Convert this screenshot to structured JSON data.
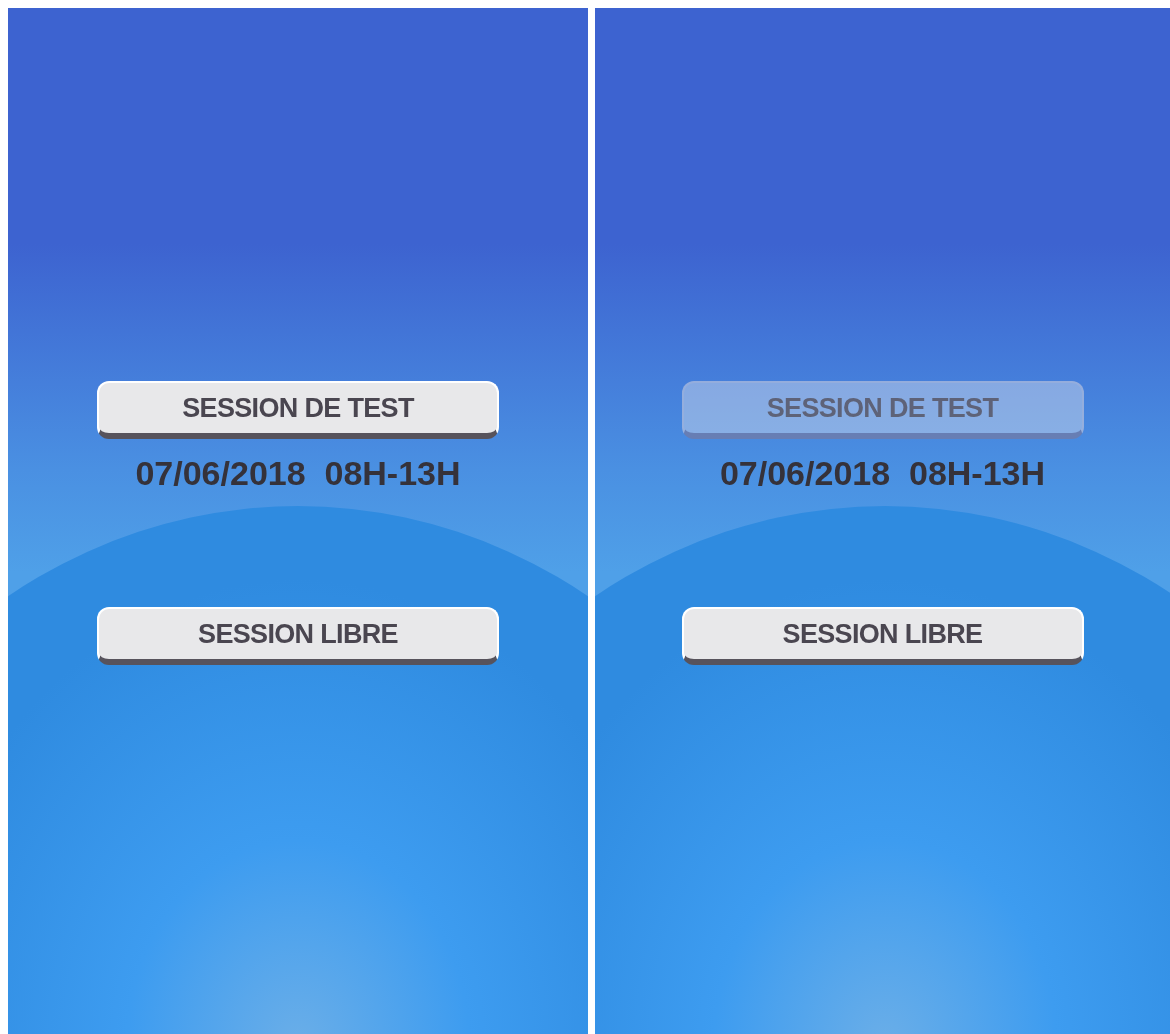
{
  "screens": [
    {
      "test_button": {
        "label": "SESSION DE TEST",
        "disabled": false
      },
      "session_time": "07/06/2018  08H-13H",
      "free_button": {
        "label": "SESSION LIBRE",
        "disabled": false
      }
    },
    {
      "test_button": {
        "label": "SESSION DE TEST",
        "disabled": true
      },
      "session_time": "07/06/2018  08H-13H",
      "free_button": {
        "label": "SESSION LIBRE",
        "disabled": false
      }
    }
  ]
}
